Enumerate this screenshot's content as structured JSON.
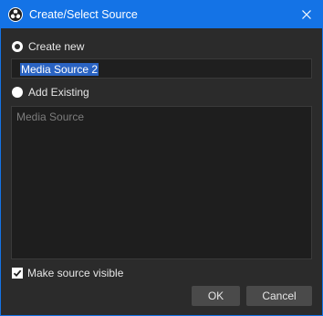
{
  "window": {
    "title": "Create/Select Source"
  },
  "create_new": {
    "label": "Create new",
    "selected": true,
    "name_value": "Media Source 2"
  },
  "add_existing": {
    "label": "Add Existing",
    "selected": false,
    "items": [
      "Media Source"
    ]
  },
  "options": {
    "make_visible_label": "Make source visible",
    "make_visible_checked": true
  },
  "buttons": {
    "ok": "OK",
    "cancel": "Cancel"
  },
  "colors": {
    "titlebar": "#1473e6",
    "background": "#2b2b2b",
    "selection": "#2a63c2"
  },
  "icons": {
    "app": "obs-logo-icon",
    "close": "close-icon",
    "check": "checkmark-icon"
  }
}
